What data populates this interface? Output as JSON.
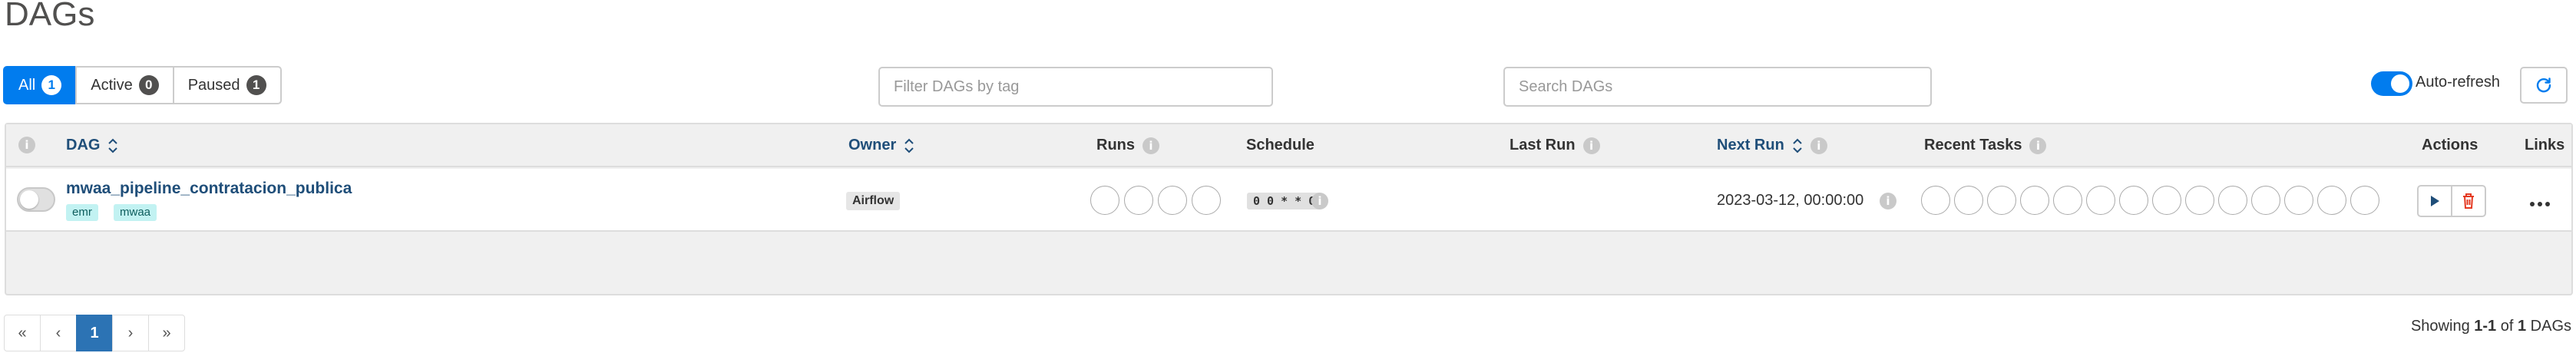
{
  "page_title": "DAGs",
  "status_tabs": [
    {
      "label": "All",
      "count": "1"
    },
    {
      "label": "Active",
      "count": "0"
    },
    {
      "label": "Paused",
      "count": "1"
    }
  ],
  "filters": {
    "tag_placeholder": "Filter DAGs by tag",
    "search_placeholder": "Search DAGs"
  },
  "auto_refresh": {
    "label": "Auto-refresh",
    "enabled": true
  },
  "table": {
    "columns": {
      "dag": "DAG",
      "owner": "Owner",
      "runs": "Runs",
      "schedule": "Schedule",
      "last_run": "Last Run",
      "next_run": "Next Run",
      "recent_tasks": "Recent Tasks",
      "actions": "Actions",
      "links": "Links"
    },
    "rows": [
      {
        "dag_id": "mwaa_pipeline_contratacion_publica",
        "paused": true,
        "tags": [
          "emr",
          "mwaa"
        ],
        "owner": "Airflow",
        "schedule": "0 0 * * 0",
        "last_run": "",
        "next_run": "2023-03-12, 00:00:00"
      }
    ]
  },
  "pagination": {
    "first": "«",
    "prev": "‹",
    "current": "1",
    "next": "›",
    "last": "»"
  },
  "footer": {
    "showing_prefix": "Showing",
    "range": "1-1",
    "of": "of",
    "total": "1",
    "suffix": "DAGs"
  },
  "colors": {
    "accent": "#017cee",
    "link": "#1f4e79",
    "delete": "#e43921",
    "tag_bg": "#c2f2f2"
  },
  "icons": {
    "sort": "sort-updown-icon",
    "info": "info-circle-icon",
    "refresh": "refresh-icon",
    "trigger": "play-icon",
    "delete": "trash-icon",
    "links": "ellipsis-icon"
  }
}
